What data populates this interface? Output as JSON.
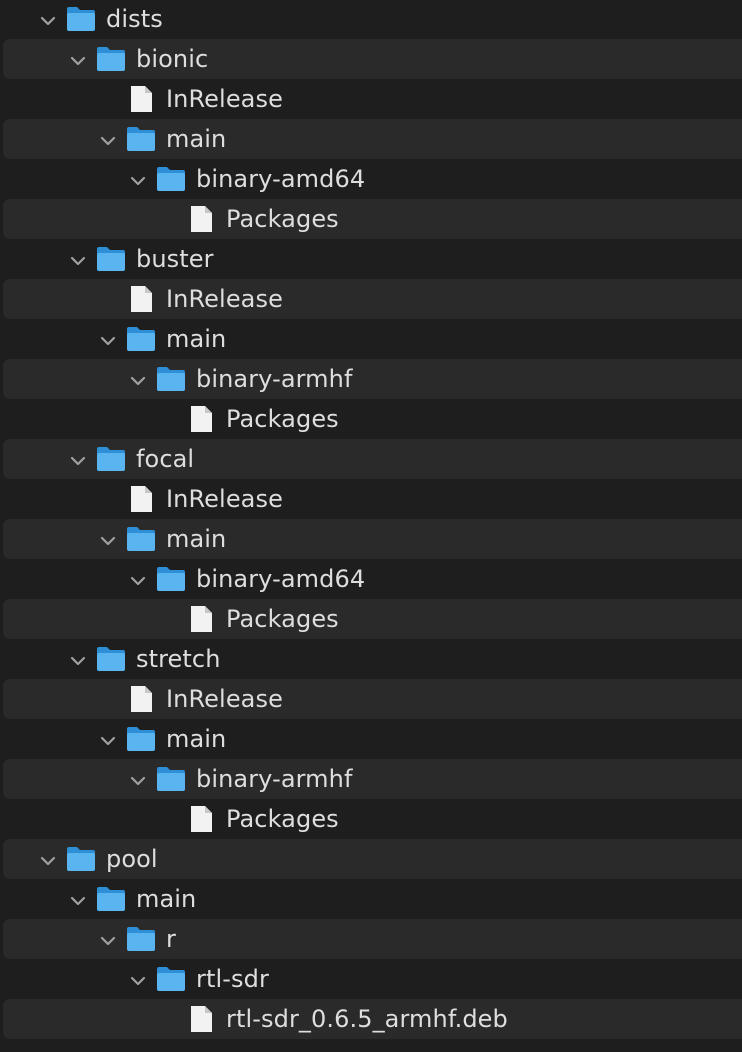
{
  "tree": [
    {
      "label": "dists",
      "type": "folder",
      "depth": 0,
      "expanded": true
    },
    {
      "label": "bionic",
      "type": "folder",
      "depth": 1,
      "expanded": true
    },
    {
      "label": "InRelease",
      "type": "file",
      "depth": 2
    },
    {
      "label": "main",
      "type": "folder",
      "depth": 2,
      "expanded": true
    },
    {
      "label": "binary-amd64",
      "type": "folder",
      "depth": 3,
      "expanded": true
    },
    {
      "label": "Packages",
      "type": "file",
      "depth": 4
    },
    {
      "label": "buster",
      "type": "folder",
      "depth": 1,
      "expanded": true
    },
    {
      "label": "InRelease",
      "type": "file",
      "depth": 2
    },
    {
      "label": "main",
      "type": "folder",
      "depth": 2,
      "expanded": true
    },
    {
      "label": "binary-armhf",
      "type": "folder",
      "depth": 3,
      "expanded": true
    },
    {
      "label": "Packages",
      "type": "file",
      "depth": 4
    },
    {
      "label": "focal",
      "type": "folder",
      "depth": 1,
      "expanded": true
    },
    {
      "label": "InRelease",
      "type": "file",
      "depth": 2
    },
    {
      "label": "main",
      "type": "folder",
      "depth": 2,
      "expanded": true
    },
    {
      "label": "binary-amd64",
      "type": "folder",
      "depth": 3,
      "expanded": true
    },
    {
      "label": "Packages",
      "type": "file",
      "depth": 4
    },
    {
      "label": "stretch",
      "type": "folder",
      "depth": 1,
      "expanded": true
    },
    {
      "label": "InRelease",
      "type": "file",
      "depth": 2
    },
    {
      "label": "main",
      "type": "folder",
      "depth": 2,
      "expanded": true
    },
    {
      "label": "binary-armhf",
      "type": "folder",
      "depth": 3,
      "expanded": true
    },
    {
      "label": "Packages",
      "type": "file",
      "depth": 4
    },
    {
      "label": "pool",
      "type": "folder",
      "depth": 0,
      "expanded": true
    },
    {
      "label": "main",
      "type": "folder",
      "depth": 1,
      "expanded": true
    },
    {
      "label": "r",
      "type": "folder",
      "depth": 2,
      "expanded": true
    },
    {
      "label": "rtl-sdr",
      "type": "folder",
      "depth": 3,
      "expanded": true
    },
    {
      "label": "rtl-sdr_0.6.5_armhf.deb",
      "type": "file",
      "depth": 4
    }
  ],
  "icons": {
    "folder": "folder-icon",
    "file": "file-icon",
    "chevron": "chevron-down-icon"
  },
  "colors": {
    "background": "#1e1e1e",
    "stripe": "#2a2a2a",
    "text": "#dedede",
    "chevron": "#a0a0a0",
    "folder_front": "#5ab4f0",
    "folder_back": "#2e8fd6",
    "file_body": "#f2f2f2",
    "file_fold": "#c8c8c8"
  }
}
